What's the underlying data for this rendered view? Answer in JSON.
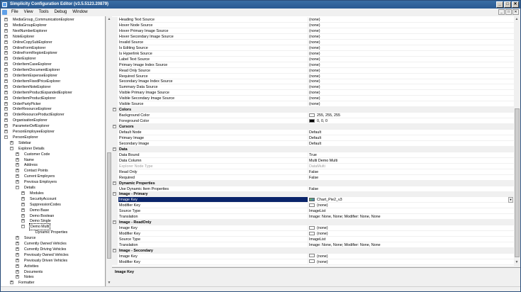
{
  "window": {
    "title": "Simplicity Configuration Editor (v3.5.5123.20879)",
    "controls": [
      "_",
      "□",
      "✕"
    ],
    "mdi_controls": [
      "_",
      "□",
      "✕"
    ]
  },
  "menu": [
    "File",
    "View",
    "Tools",
    "Debug",
    "Window"
  ],
  "tree": [
    {
      "label": "MediaGroup_CommunicationExplorer",
      "depth": 3,
      "expander": "+"
    },
    {
      "label": "MediaGroupExplorer",
      "depth": 3,
      "expander": "+"
    },
    {
      "label": "NextNumberExplorer",
      "depth": 3,
      "expander": "+"
    },
    {
      "label": "NoteExplorer",
      "depth": 3,
      "expander": "+"
    },
    {
      "label": "OnlineCopySubExplorer",
      "depth": 3,
      "expander": "+"
    },
    {
      "label": "OnlineFormExplorer",
      "depth": 3,
      "expander": "+"
    },
    {
      "label": "OnlineFormRegionExplorer",
      "depth": 3,
      "expander": "+"
    },
    {
      "label": "OrderExplorer",
      "depth": 3,
      "expander": "+"
    },
    {
      "label": "OrderItemCaseExplorer",
      "depth": 3,
      "expander": "+"
    },
    {
      "label": "OrderItemDocumentExplorer",
      "depth": 3,
      "expander": "+"
    },
    {
      "label": "OrderItemExpenseExplorer",
      "depth": 3,
      "expander": "+"
    },
    {
      "label": "OrderItemFixedPriceExplorer",
      "depth": 3,
      "expander": "+"
    },
    {
      "label": "OrderItemNoteExplorer",
      "depth": 3,
      "expander": "+"
    },
    {
      "label": "OrderItemProductExpandedExplorer",
      "depth": 3,
      "expander": "+"
    },
    {
      "label": "OrderItemProductExplorer",
      "depth": 3,
      "expander": "+"
    },
    {
      "label": "OrderPartyPicker",
      "depth": 3,
      "expander": "+"
    },
    {
      "label": "OrderResourceExplorer",
      "depth": 3,
      "expander": "+"
    },
    {
      "label": "OrderResourceProductExplorer",
      "depth": 3,
      "expander": "+"
    },
    {
      "label": "OrganisationExplorer",
      "depth": 3,
      "expander": "+"
    },
    {
      "label": "ParameterDefExplorer",
      "depth": 3,
      "expander": "+"
    },
    {
      "label": "PersonEmployeeExplorer",
      "depth": 3,
      "expander": "+"
    },
    {
      "label": "PersonExplorer",
      "depth": 3,
      "expander": "−"
    },
    {
      "label": "Sidebar",
      "depth": 4,
      "expander": "+"
    },
    {
      "label": "Explorer Details",
      "depth": 4,
      "expander": "−"
    },
    {
      "label": "Customer Code",
      "depth": 5,
      "expander": "+"
    },
    {
      "label": "Name",
      "depth": 5,
      "expander": "+"
    },
    {
      "label": "Address",
      "depth": 5,
      "expander": "+"
    },
    {
      "label": "Contact Points",
      "depth": 5,
      "expander": "+"
    },
    {
      "label": "Current Employers",
      "depth": 5,
      "expander": "+"
    },
    {
      "label": "Previous Employers",
      "depth": 5,
      "expander": "+"
    },
    {
      "label": "Details",
      "depth": 5,
      "expander": "−"
    },
    {
      "label": "Modules",
      "depth": 6,
      "expander": "+"
    },
    {
      "label": "SecurityAccount",
      "depth": 6,
      "expander": "+"
    },
    {
      "label": "SuppressionCodes",
      "depth": 6,
      "expander": "+"
    },
    {
      "label": "Demo Base",
      "depth": 6,
      "expander": "+"
    },
    {
      "label": "Demo Boolean",
      "depth": 6,
      "expander": "+"
    },
    {
      "label": "Demo Single",
      "depth": 6,
      "expander": "+"
    },
    {
      "label": "Demo Multi",
      "depth": 6,
      "expander": "−",
      "selected": true
    },
    {
      "label": "Dynamic Properties",
      "depth": 7,
      "expander": ""
    },
    {
      "label": "Source",
      "depth": 5,
      "expander": "+"
    },
    {
      "label": "Currently Owned Vehicles",
      "depth": 5,
      "expander": "+"
    },
    {
      "label": "Currently Driving Vehicles",
      "depth": 5,
      "expander": "+"
    },
    {
      "label": "Previously Owned Vehicles",
      "depth": 5,
      "expander": "+"
    },
    {
      "label": "Previously Driven Vehicles",
      "depth": 5,
      "expander": "+"
    },
    {
      "label": "Activities",
      "depth": 5,
      "expander": "+"
    },
    {
      "label": "Documents",
      "depth": 5,
      "expander": "+"
    },
    {
      "label": "Notes",
      "depth": 5,
      "expander": "+"
    },
    {
      "label": "Formatter",
      "depth": 4,
      "expander": "+"
    }
  ],
  "grid": [
    {
      "name": "Heading Text Source",
      "value": "(none)"
    },
    {
      "name": "Hover Node Source",
      "value": "(none)"
    },
    {
      "name": "Hover Primary Image Source",
      "value": "(none)"
    },
    {
      "name": "Hover Secondary Image Source",
      "value": "(none)"
    },
    {
      "name": "Invalid Source",
      "value": "(none)"
    },
    {
      "name": "Is Editing Source",
      "value": "(none)"
    },
    {
      "name": "Is Hyperlink Source",
      "value": "(none)"
    },
    {
      "name": "Label Text Source",
      "value": "(none)"
    },
    {
      "name": "Primary Image Index Source",
      "value": "(none)"
    },
    {
      "name": "Read Only Source",
      "value": "(none)"
    },
    {
      "name": "Required Source",
      "value": "(none)"
    },
    {
      "name": "Secondary Image Index Source",
      "value": "(none)"
    },
    {
      "name": "Summary Data Source",
      "value": "(none)"
    },
    {
      "name": "Visible Primary Image Source",
      "value": "(none)"
    },
    {
      "name": "Visible Secondary Image Source",
      "value": "(none)"
    },
    {
      "name": "Visible Source",
      "value": "(none)"
    },
    {
      "category": "Colors"
    },
    {
      "name": "Background Color",
      "value": "255, 255, 255",
      "swatch": "#ffffff"
    },
    {
      "name": "Foreground Color",
      "value": "0, 0, 0",
      "swatch": "#000000"
    },
    {
      "category": "Cursors"
    },
    {
      "name": "Default Node",
      "value": "Default"
    },
    {
      "name": "Primary Image",
      "value": "Default"
    },
    {
      "name": "Secondary Image",
      "value": "Default"
    },
    {
      "category": "Data"
    },
    {
      "name": "Data Bound",
      "value": "True"
    },
    {
      "name": "Data Column",
      "value": "Multi Demo Multi"
    },
    {
      "name": "Explorer Node Type",
      "value": "DataMulti",
      "disabled": true
    },
    {
      "name": "Read Only",
      "value": "False"
    },
    {
      "name": "Required",
      "value": "False"
    },
    {
      "category": "Dynamic Properties"
    },
    {
      "name": "Use Dynamic Item Properties",
      "value": "False"
    },
    {
      "category": "Image - Primary"
    },
    {
      "name": "Image Key",
      "value": "Chart_Pie2_v3",
      "image": true,
      "selected": true,
      "dropdown": "▼"
    },
    {
      "name": "Modifier Key",
      "value": "(none)",
      "swatch": "#ffffff"
    },
    {
      "name": "Source Type",
      "value": "ImageList"
    },
    {
      "name": "Translation",
      "value": "Image: None, None; Modifier: None, None"
    },
    {
      "category": "Image - ReadOnly"
    },
    {
      "name": "Image Key",
      "value": "(none)",
      "swatch": "#ffffff"
    },
    {
      "name": "Modifier Key",
      "value": "(none)",
      "swatch": "#ffffff"
    },
    {
      "name": "Source Type",
      "value": "ImageList"
    },
    {
      "name": "Translation",
      "value": "Image: None, None; Modifier: None, None"
    },
    {
      "category": "Image - Secondary"
    },
    {
      "name": "Image Key",
      "value": "(none)",
      "swatch": "#ffffff"
    },
    {
      "name": "Modifier Key",
      "value": "(none)",
      "swatch": "#ffffff"
    }
  ],
  "description": {
    "title": "Image Key"
  },
  "colors": {
    "title_bar": "#2a5a92",
    "selection": "#0a246a",
    "panel": "#f0f0f0"
  }
}
